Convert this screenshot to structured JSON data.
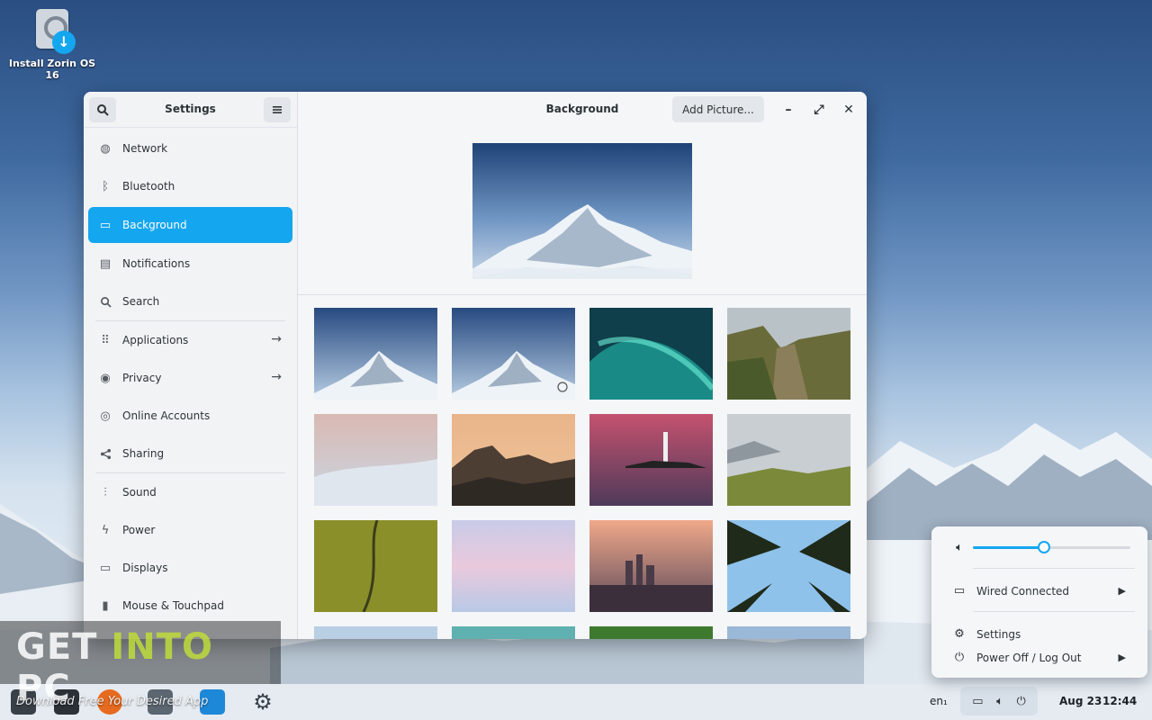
{
  "desktop": {
    "icon_label": "Install Zorin OS 16"
  },
  "settings_window": {
    "sidebar_title": "Settings",
    "panel_title": "Background",
    "add_picture_label": "Add Picture...",
    "sidebar_items": [
      {
        "label": "Network",
        "icon": "network-icon"
      },
      {
        "label": "Bluetooth",
        "icon": "bluetooth-icon"
      },
      {
        "label": "Background",
        "icon": "monitor-icon",
        "active": true
      },
      {
        "label": "Notifications",
        "icon": "notifications-icon"
      },
      {
        "label": "Search",
        "icon": "search-icon"
      },
      {
        "label": "Applications",
        "icon": "apps-grid-icon",
        "has_arrow": true
      },
      {
        "label": "Privacy",
        "icon": "privacy-icon",
        "has_arrow": true
      },
      {
        "label": "Online Accounts",
        "icon": "online-accounts-icon"
      },
      {
        "label": "Sharing",
        "icon": "share-icon"
      },
      {
        "label": "Sound",
        "icon": "sound-icon"
      },
      {
        "label": "Power",
        "icon": "power-icon"
      },
      {
        "label": "Displays",
        "icon": "display-icon"
      },
      {
        "label": "Mouse & Touchpad",
        "icon": "mouse-icon"
      }
    ],
    "wallpapers": [
      "mountain-snow",
      "mountain-snow-selected",
      "aurora",
      "canyon",
      "pink-dunes",
      "sunset-hills",
      "lighthouse",
      "misty-valley",
      "green-field",
      "pastel-sky",
      "city-skyline",
      "palm-trees"
    ]
  },
  "watermark": {
    "text_part1": "GET ",
    "text_part2": "INTO",
    "text_part3": " PC",
    "tagline": "Download Free Your Desired App"
  },
  "taskbar": {
    "keyboard_layout": "en₁",
    "clock_date": "Aug 23",
    "clock_time": "12:44"
  },
  "quick_settings": {
    "volume_level": 0.45,
    "network_label": "Wired Connected",
    "settings_label": "Settings",
    "power_label": "Power Off / Log Out"
  },
  "colors": {
    "accent": "#15a6f0"
  }
}
